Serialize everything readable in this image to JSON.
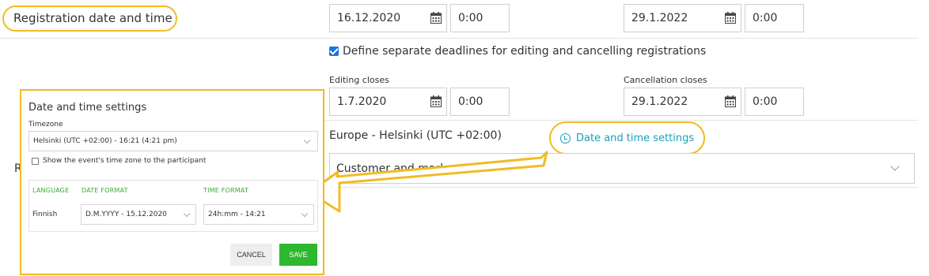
{
  "registration": {
    "label": "Registration date and time",
    "start_date": "16.12.2020",
    "start_time": "0:00",
    "end_date": "29.1.2022",
    "end_time": "0:00"
  },
  "separate_deadlines": {
    "checked": true,
    "label": "Define separate deadlines for editing and cancelling registrations"
  },
  "editing": {
    "label": "Editing closes",
    "date": "1.7.2020",
    "time": "0:00"
  },
  "cancellation": {
    "label": "Cancellation closes",
    "date": "29.1.2022",
    "time": "0:00"
  },
  "timezone_text": "Europe - Helsinki (UTC +02:00)",
  "date_time_settings_link": "Date and time settings",
  "row_letter": "R",
  "customer_select": {
    "value": "Customer and mark"
  },
  "modal": {
    "title": "Date and time settings",
    "timezone_label": "Timezone",
    "timezone_value": "Helsinki (UTC +02:00) - 16:21 (4:21 pm)",
    "show_tz_label": "Show the event's time zone to the participant",
    "table": {
      "headers": [
        "LANGUAGE",
        "DATE FORMAT",
        "TIME FORMAT"
      ],
      "row": {
        "language": "Finnish",
        "date_format": "D.M.YYYY - 15.12.2020",
        "time_format": "24h:mm - 14:21"
      }
    },
    "cancel_label": "CANCEL",
    "save_label": "SAVE"
  },
  "colors": {
    "highlight": "#f1bc22",
    "link": "#17a2b8",
    "save": "#2eb82e",
    "table_header": "#3aaa35"
  }
}
